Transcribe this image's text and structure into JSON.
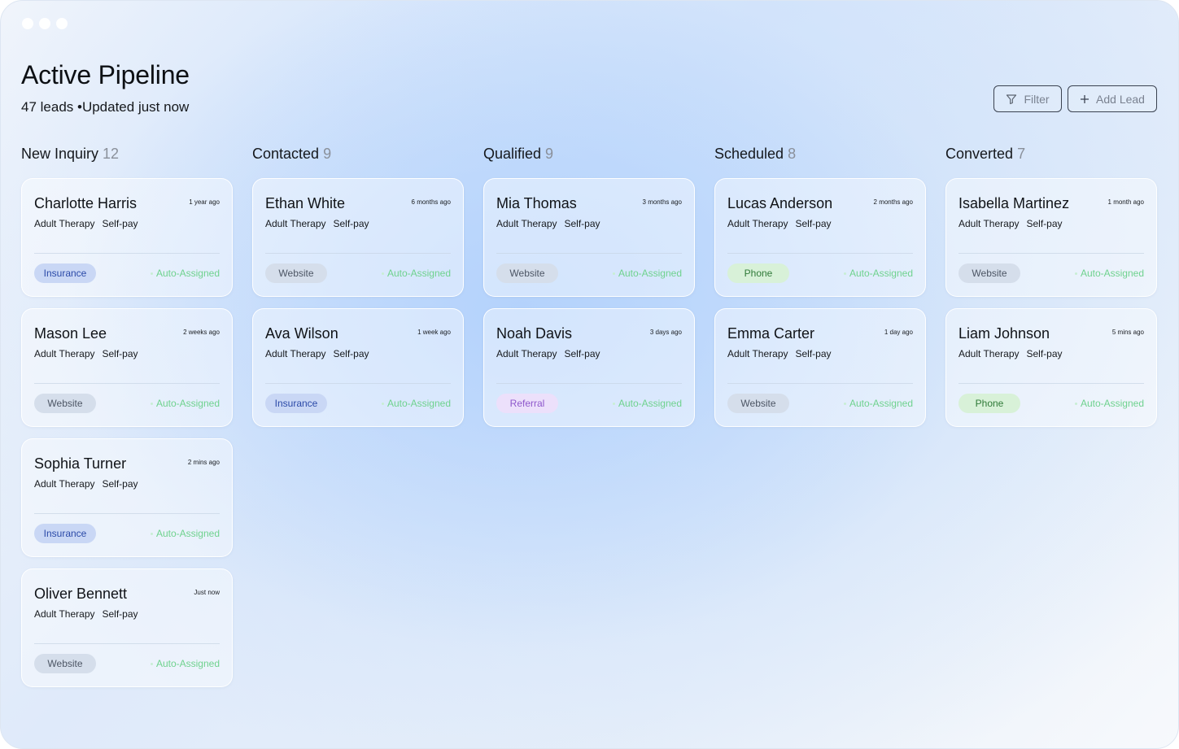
{
  "header": {
    "title": "Active Pipeline",
    "subtitle": "47 leads •Updated just now",
    "filter_label": "Filter",
    "add_lead_label": "Add Lead"
  },
  "colors": {
    "insurance": "#c9d7f5",
    "website": "#d5deeb",
    "phone": "#d8f1d8",
    "referral": "#ece0fb",
    "auto_assigned": "#6fd28e"
  },
  "columns": [
    {
      "name": "New Inquiry",
      "count": "12",
      "cards": [
        {
          "name": "Charlotte Harris",
          "time": "1 year ago",
          "service": "Adult Therapy",
          "payment": "Self-pay",
          "source": "Insurance",
          "status": "Auto-Assigned"
        },
        {
          "name": "Mason Lee",
          "time": "2 weeks ago",
          "service": "Adult Therapy",
          "payment": "Self-pay",
          "source": "Website",
          "status": "Auto-Assigned"
        },
        {
          "name": "Sophia Turner",
          "time": "2 mins ago",
          "service": "Adult Therapy",
          "payment": "Self-pay",
          "source": "Insurance",
          "status": "Auto-Assigned"
        },
        {
          "name": "Oliver Bennett",
          "time": "Just now",
          "service": "Adult Therapy",
          "payment": "Self-pay",
          "source": "Website",
          "status": "Auto-Assigned"
        }
      ]
    },
    {
      "name": "Contacted",
      "count": "9",
      "cards": [
        {
          "name": "Ethan White",
          "time": "6 months ago",
          "service": "Adult Therapy",
          "payment": "Self-pay",
          "source": "Website",
          "status": "Auto-Assigned"
        },
        {
          "name": "Ava Wilson",
          "time": "1 week ago",
          "service": "Adult Therapy",
          "payment": "Self-pay",
          "source": "Insurance",
          "status": "Auto-Assigned"
        }
      ]
    },
    {
      "name": "Qualified",
      "count": "9",
      "cards": [
        {
          "name": "Mia Thomas",
          "time": "3 months ago",
          "service": "Adult Therapy",
          "payment": "Self-pay",
          "source": "Website",
          "status": "Auto-Assigned"
        },
        {
          "name": "Noah Davis",
          "time": "3 days ago",
          "service": "Adult Therapy",
          "payment": "Self-pay",
          "source": "Referral",
          "status": "Auto-Assigned"
        }
      ]
    },
    {
      "name": "Scheduled",
      "count": "8",
      "cards": [
        {
          "name": "Lucas Anderson",
          "time": "2 months ago",
          "service": "Adult Therapy",
          "payment": "Self-pay",
          "source": "Phone",
          "status": "Auto-Assigned"
        },
        {
          "name": "Emma Carter",
          "time": "1 day ago",
          "service": "Adult Therapy",
          "payment": "Self-pay",
          "source": "Website",
          "status": "Auto-Assigned"
        }
      ]
    },
    {
      "name": "Converted",
      "count": "7",
      "cards": [
        {
          "name": "Isabella Martinez",
          "time": "1 month ago",
          "service": "Adult Therapy",
          "payment": "Self-pay",
          "source": "Website",
          "status": "Auto-Assigned"
        },
        {
          "name": "Liam Johnson",
          "time": "5 mins ago",
          "service": "Adult Therapy",
          "payment": "Self-pay",
          "source": "Phone",
          "status": "Auto-Assigned"
        }
      ]
    }
  ]
}
